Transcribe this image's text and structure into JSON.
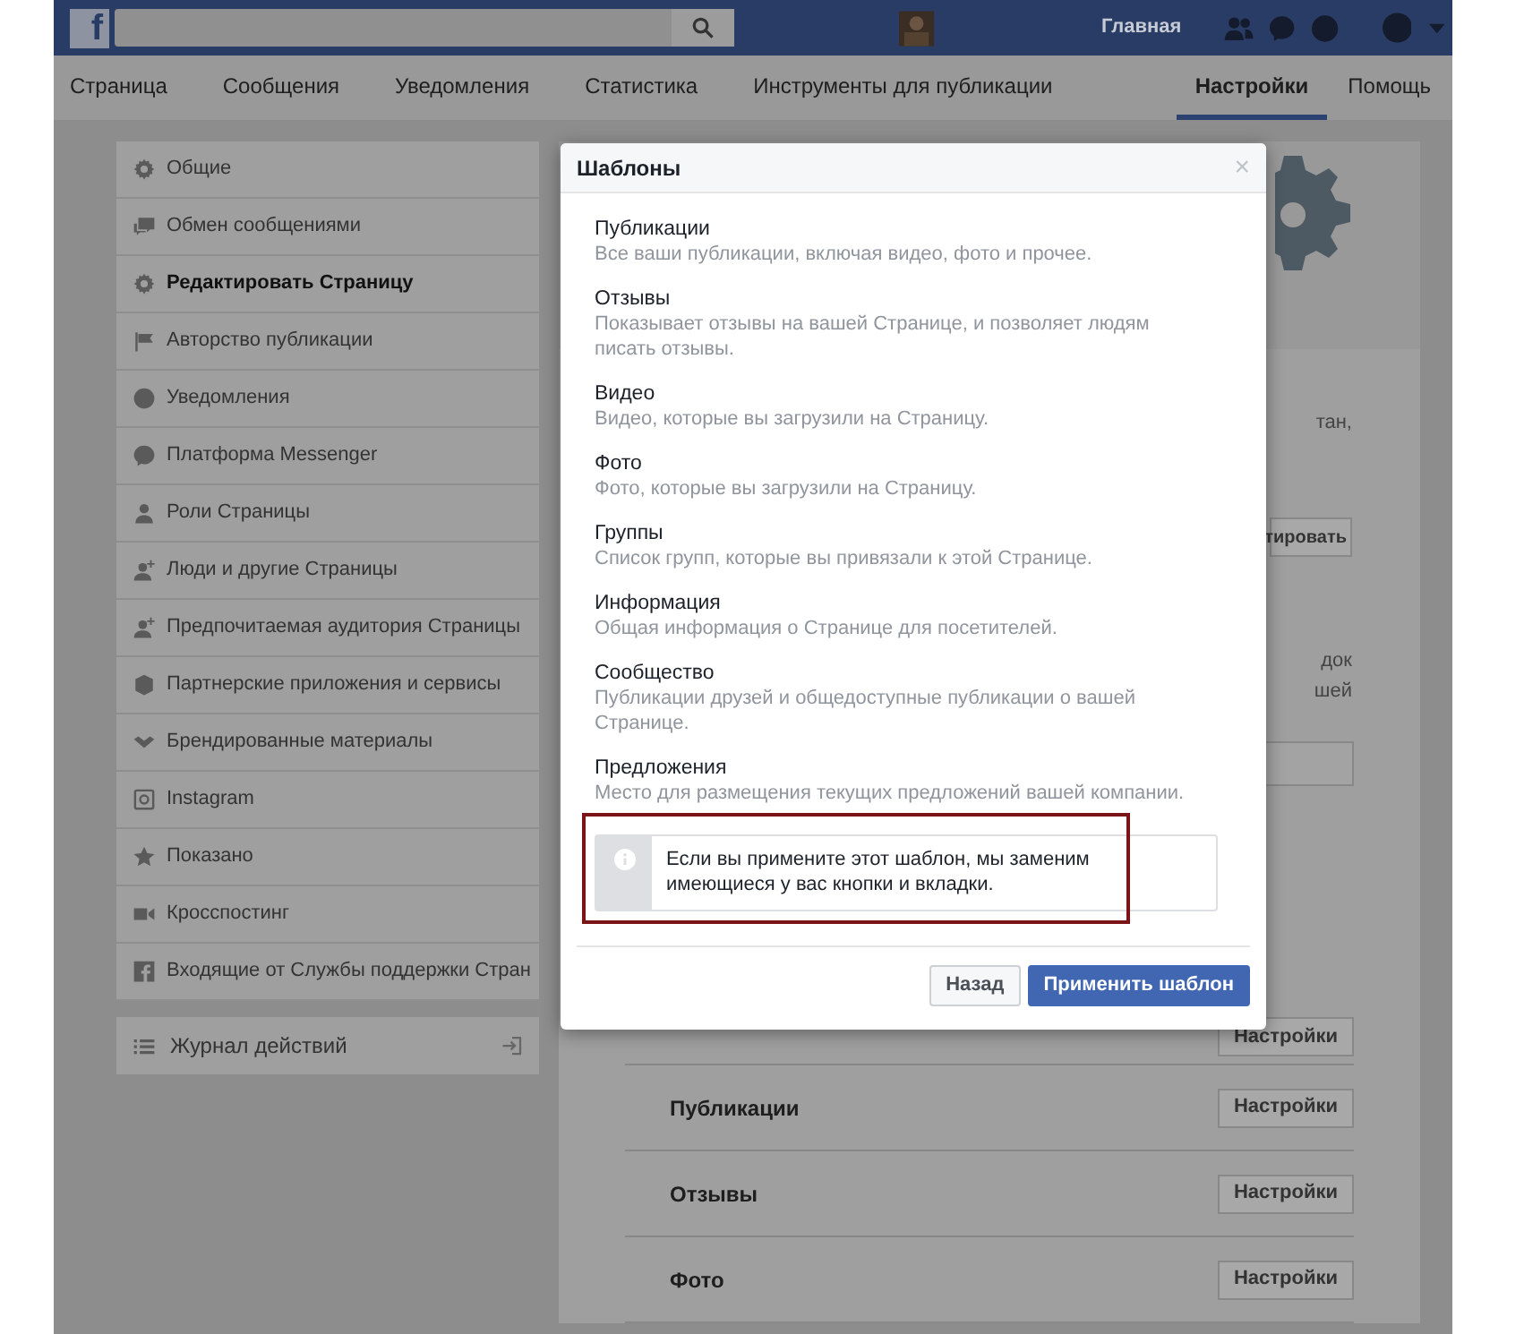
{
  "top_bar": {
    "logo": "f",
    "home": "Главная"
  },
  "nav_tabs": [
    {
      "label": "Страница",
      "selected": false
    },
    {
      "label": "Сообщения",
      "selected": false
    },
    {
      "label": "Уведомления",
      "selected": false
    },
    {
      "label": "Статистика",
      "selected": false
    },
    {
      "label": "Инструменты для публикации",
      "selected": false
    }
  ],
  "nav_right": [
    {
      "label": "Настройки",
      "selected": true
    },
    {
      "label": "Помощь",
      "selected": false
    }
  ],
  "sidebar": {
    "items": [
      {
        "label": "Общие",
        "selected": false
      },
      {
        "label": "Обмен сообщениями",
        "selected": false
      },
      {
        "label": "Редактировать Страницу",
        "selected": true
      },
      {
        "label": "Авторство публикации",
        "selected": false
      },
      {
        "label": "Уведомления",
        "selected": false
      },
      {
        "label": "Платформа Messenger",
        "selected": false
      },
      {
        "label": "Роли Страницы",
        "selected": false
      },
      {
        "label": "Люди и другие Страницы",
        "selected": false
      },
      {
        "label": "Предпочитаемая аудитория Страницы",
        "selected": false
      },
      {
        "label": "Партнерские приложения и сервисы",
        "selected": false
      },
      {
        "label": "Брендированные материалы",
        "selected": false
      },
      {
        "label": "Instagram",
        "selected": false
      },
      {
        "label": "Показано",
        "selected": false
      },
      {
        "label": "Кросспостинг",
        "selected": false
      },
      {
        "label": "Входящие от Службы поддержки Стран",
        "selected": false
      }
    ],
    "activity_log": "Журнал действий"
  },
  "background_panel": {
    "fragments": [
      "тан,",
      "тировать",
      "док",
      "шей"
    ],
    "rows": [
      {
        "label": "",
        "button": "Настройки"
      },
      {
        "label": "Публикации",
        "button": "Настройки"
      },
      {
        "label": "Отзывы",
        "button": "Настройки"
      },
      {
        "label": "Фото",
        "button": "Настройки"
      }
    ]
  },
  "dialog": {
    "title": "Шаблоны",
    "close": "×",
    "sections": [
      {
        "title": "Публикации",
        "description": "Все ваши публикации, включая видео, фото и прочее."
      },
      {
        "title": "Отзывы",
        "description": "Показывает отзывы на вашей Странице, и позволяет людям писать отзывы."
      },
      {
        "title": "Видео",
        "description": "Видео, которые вы загрузили на Страницу."
      },
      {
        "title": "Фото",
        "description": "Фото, которые вы загрузили на Страницу."
      },
      {
        "title": "Группы",
        "description": "Список групп, которые вы привязали к этой Странице."
      },
      {
        "title": "Информация",
        "description": "Общая информация о Странице для посетителей."
      },
      {
        "title": "Сообщество",
        "description": "Публикации друзей и общедоступные публикации о вашей Странице."
      },
      {
        "title": "Предложения",
        "description": "Место для размещения текущих предложений вашей компании."
      }
    ],
    "notice": "Если вы примените этот шаблон, мы заменим имеющиеся у вас кнопки и вкладки.",
    "notice_highlighted": true,
    "buttons": [
      {
        "label": "Назад",
        "kind": "secondary"
      },
      {
        "label": "Применить шаблон",
        "kind": "primary"
      }
    ]
  }
}
